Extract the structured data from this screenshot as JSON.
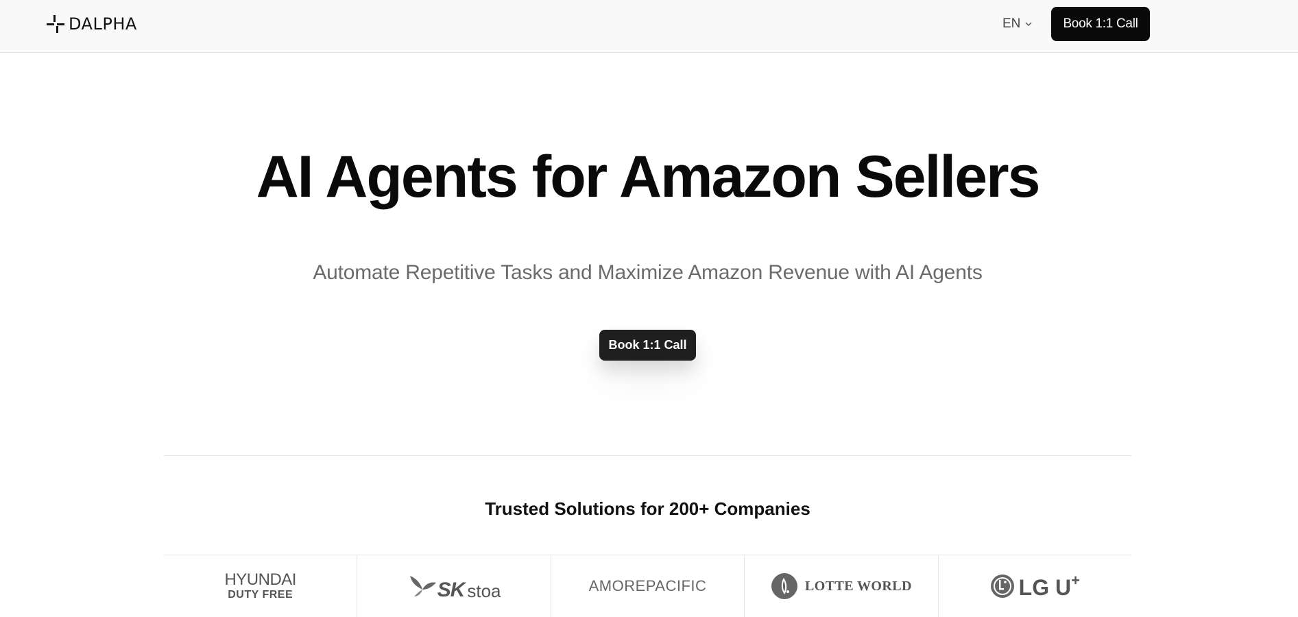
{
  "header": {
    "logo_text": "DALPHA",
    "language": "EN",
    "cta_label": "Book 1:1 Call"
  },
  "hero": {
    "title": "AI Agents for Amazon Sellers",
    "subtitle": "Automate Repetitive Tasks and Maximize Amazon Revenue with AI Agents",
    "cta_label": "Book 1:1 Call"
  },
  "trusted": {
    "heading": "Trusted Solutions for 200+ Companies",
    "logos": [
      {
        "line1": "HYUNDAI",
        "line2": "DUTY FREE"
      },
      {
        "part1": "SK",
        "part2": "stoa"
      },
      {
        "text": "AMOREPACIFIC"
      },
      {
        "text": "LOTTE WORLD"
      },
      {
        "text": "LG U",
        "sup": "+"
      }
    ]
  },
  "colors": {
    "header_bg": "#f9f9f9",
    "button_bg": "#0a0a0a",
    "subtitle_text": "#6b6b6b",
    "logo_gray": "#555555"
  }
}
